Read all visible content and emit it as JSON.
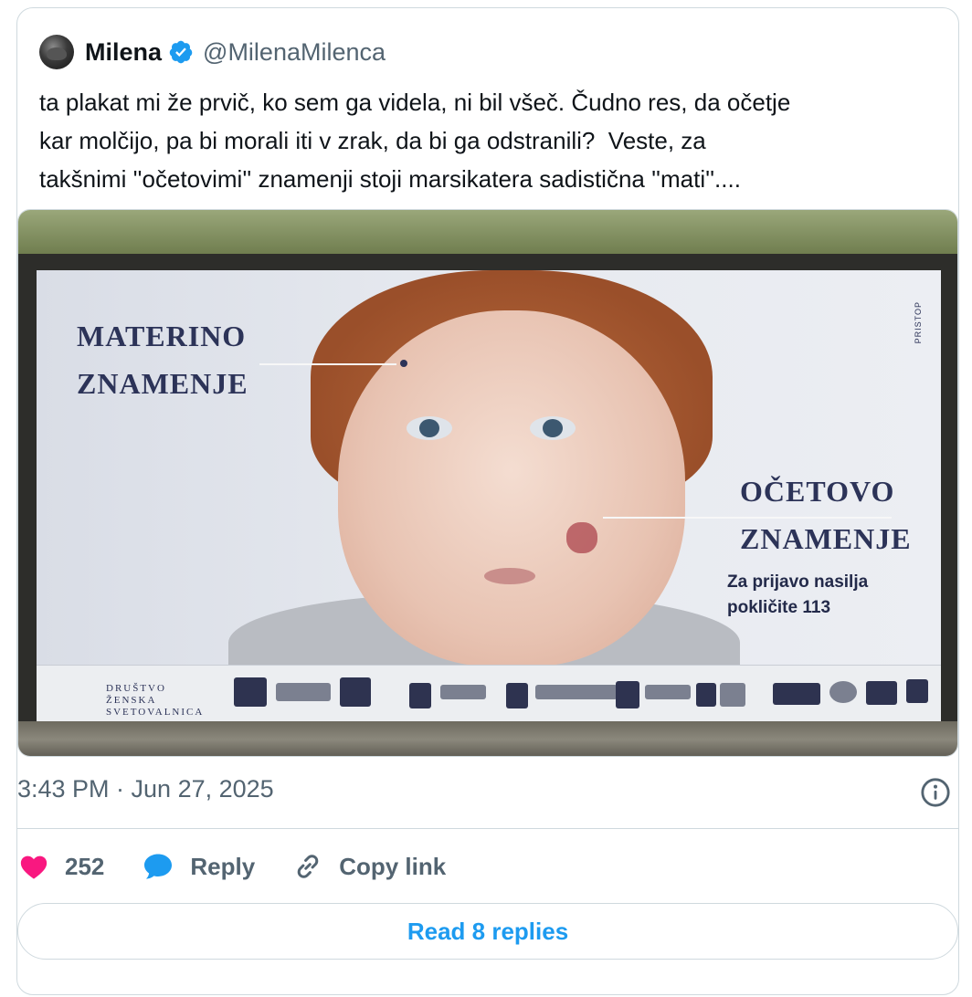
{
  "author": {
    "name": "Milena",
    "handle": "@MilenaMilenca",
    "verified_icon": "verified-badge-icon",
    "accent_color": "#1d9bf0"
  },
  "tweet": {
    "text": "ta plakat mi že prvič, ko sem ga videla, ni bil všeč. Čudno res, da očetje\nkar molčijo, pa bi morali iti v zrak, da bi ga odstranili?  Veste, za\ntakšnimi ''očetovimi'' znamenji stoji marsikatera sadistična ''mati''....",
    "timestamp": "3:43 PM · Jun 27, 2025"
  },
  "poster": {
    "left_title_line1": "MATERINO",
    "left_title_line2": "ZNAMENJE",
    "right_title_line1": "OČETOVO",
    "right_title_line2": "ZNAMENJE",
    "sub_line1": "Za prijavo nasilja",
    "sub_line2": "pokličite 113",
    "vertical_text": "PRISTOP",
    "org_line1": "DRUŠTVO",
    "org_line2": "ŽENSKA",
    "org_line3": "SVETOVALNICA"
  },
  "actions": {
    "likes": "252",
    "like_icon": "heart-icon",
    "reply_label": "Reply",
    "reply_icon": "speech-bubble-icon",
    "copy_label": "Copy link",
    "copy_icon": "link-icon",
    "like_color": "#f91880"
  },
  "footer": {
    "read_replies_label": "Read 8 replies"
  }
}
